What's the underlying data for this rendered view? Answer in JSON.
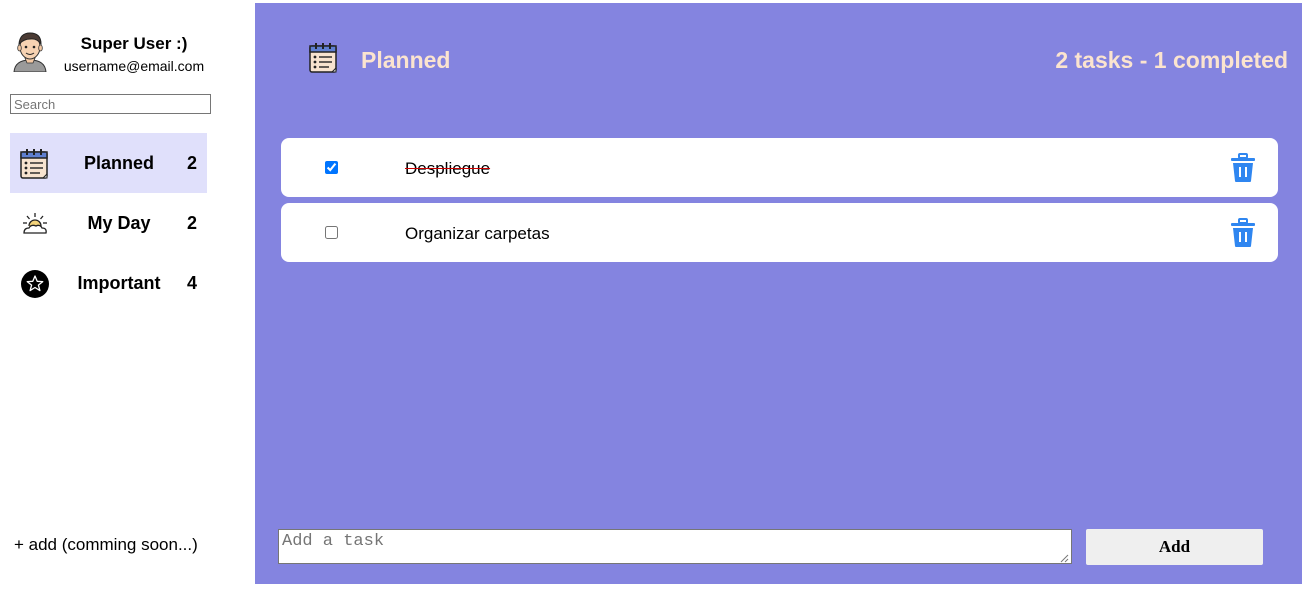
{
  "user": {
    "name": "Super User :)",
    "email": "username@email.com"
  },
  "search": {
    "placeholder": "Search",
    "value": ""
  },
  "nav": {
    "items": [
      {
        "label": "Planned",
        "count": "2",
        "icon": "planner-icon",
        "active": true
      },
      {
        "label": "My Day",
        "count": "2",
        "icon": "sun-cloud-icon",
        "active": false
      },
      {
        "label": "Important",
        "count": "4",
        "icon": "star-icon",
        "active": false
      }
    ]
  },
  "add_list_label": "+ add (comming soon...)",
  "header": {
    "title": "Planned",
    "stats": "2 tasks - 1 completed",
    "icon": "planner-icon"
  },
  "tasks": [
    {
      "text": "Despliegue",
      "completed": true
    },
    {
      "text": "Organizar carpetas",
      "completed": false
    }
  ],
  "new_task": {
    "placeholder": "Add a task",
    "value": "",
    "button_label": "Add"
  },
  "colors": {
    "main_bg": "#8484e0",
    "header_text": "#fbe4cf",
    "active_nav_bg": "#e0e0fb",
    "trash_blue": "#2f86f0",
    "strike_red": "#cc0000"
  }
}
